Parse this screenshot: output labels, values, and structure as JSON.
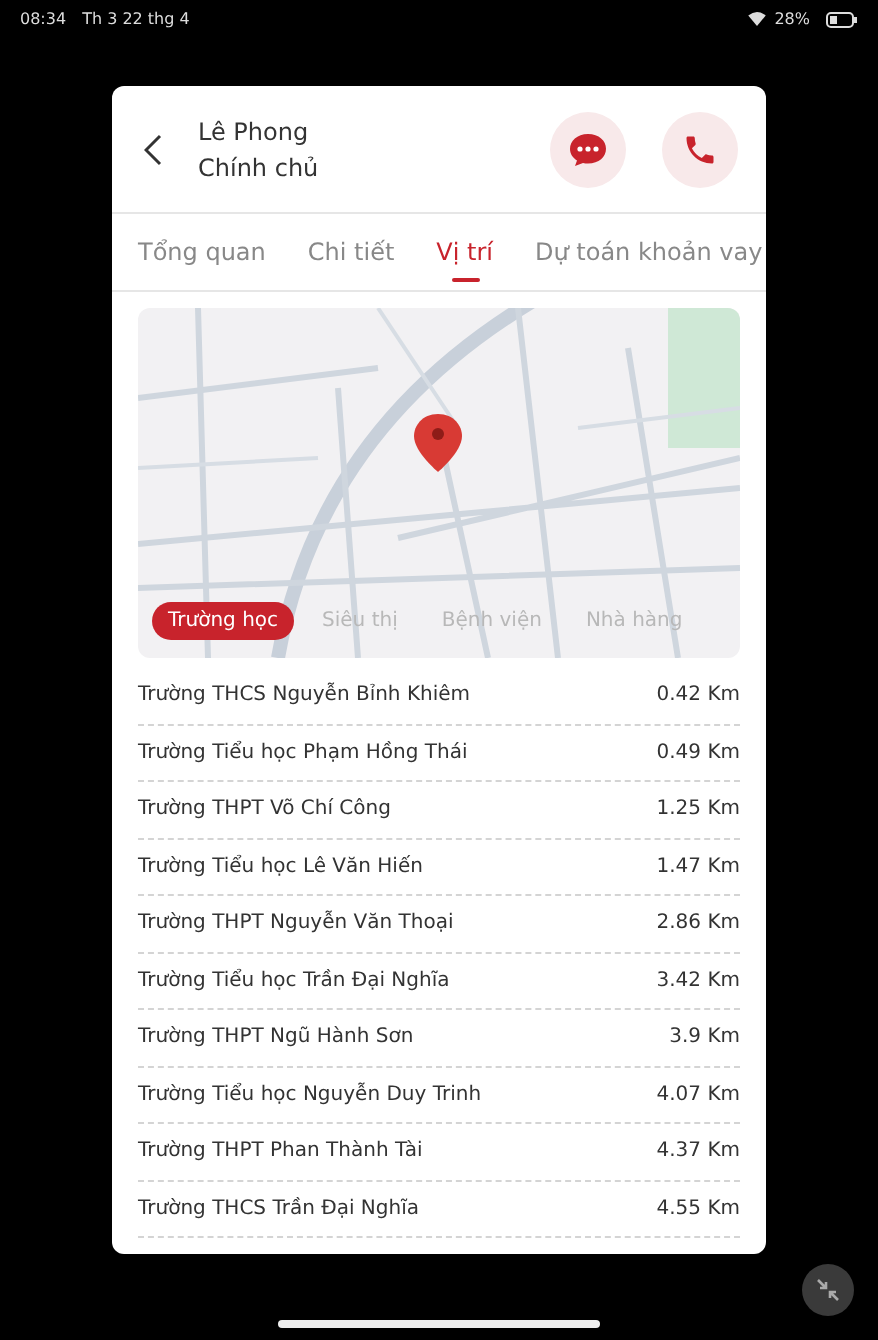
{
  "status_bar": {
    "time": "08:34",
    "date": "Th 3 22 thg 4",
    "battery": "28%"
  },
  "header": {
    "name": "Lê Phong",
    "role": "Chính chủ"
  },
  "tabs": [
    {
      "label": "Tổng quan",
      "selected": false
    },
    {
      "label": "Chi tiết",
      "selected": false
    },
    {
      "label": "Vị trí",
      "selected": true
    },
    {
      "label": "Dự toán khoản vay",
      "selected": false
    }
  ],
  "categories": [
    {
      "label": "Trường học",
      "selected": true
    },
    {
      "label": "Siêu thị",
      "selected": false
    },
    {
      "label": "Bệnh viện",
      "selected": false
    },
    {
      "label": "Nhà hàng",
      "selected": false
    }
  ],
  "places": [
    {
      "name": "Trường THCS Nguyễn Bỉnh Khiêm",
      "distance": "0.42 Km"
    },
    {
      "name": "Trường Tiểu học Phạm Hồng Thái",
      "distance": "0.49 Km"
    },
    {
      "name": "Trường THPT Võ Chí Công",
      "distance": "1.25 Km"
    },
    {
      "name": "Trường Tiểu học Lê Văn Hiến",
      "distance": "1.47 Km"
    },
    {
      "name": "Trường THPT Nguyễn Văn Thoại",
      "distance": "2.86 Km"
    },
    {
      "name": "Trường Tiểu học Trần Đại Nghĩa",
      "distance": "3.42 Km"
    },
    {
      "name": "Trường THPT Ngũ Hành Sơn",
      "distance": "3.9 Km"
    },
    {
      "name": "Trường Tiểu học Nguyễn Duy Trinh",
      "distance": "4.07 Km"
    },
    {
      "name": "Trường THPT Phan Thành Tài",
      "distance": "4.37 Km"
    },
    {
      "name": "Trường THCS Trần Đại Nghĩa",
      "distance": "4.55 Km"
    }
  ]
}
